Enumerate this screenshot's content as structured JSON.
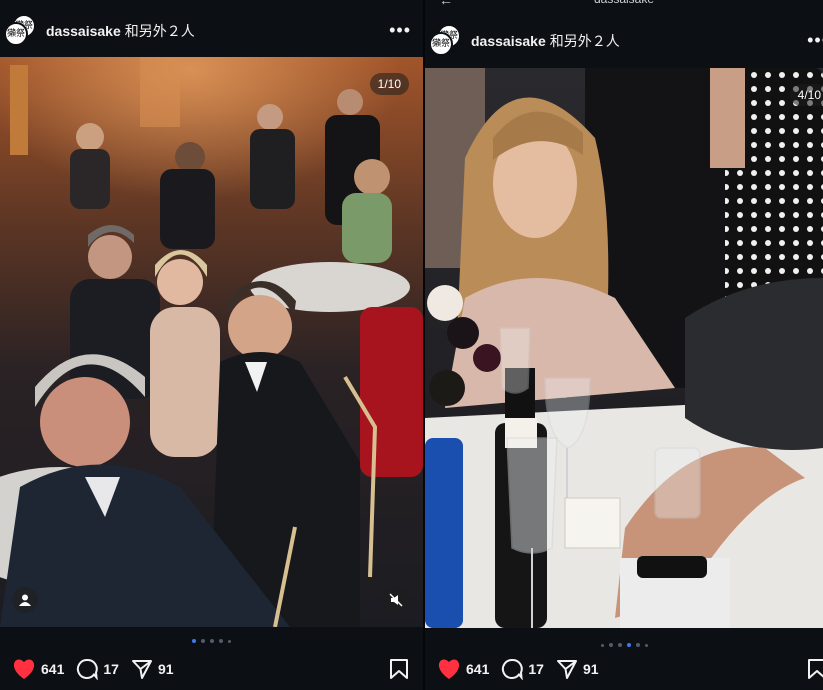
{
  "posts": [
    {
      "username": "dassaisake",
      "collab_text": "和另外２人",
      "avatar_text": "獺祭",
      "counter": "1/10",
      "likes": "641",
      "comments": "17",
      "shares": "91",
      "dots_active_index": 0
    },
    {
      "top_title": "dassaisake",
      "username": "dassaisake",
      "collab_text": "和另外２人",
      "avatar_text": "獺祭",
      "counter": "4/10",
      "likes": "641",
      "comments": "17",
      "shares": "91",
      "dots_active_index": 3
    }
  ],
  "colors": {
    "background": "#0c0f14",
    "like_red": "#ff3040",
    "dot_active": "#3c7bf0",
    "dot_inactive": "#555b66"
  },
  "icons": [
    "more-options-icon",
    "user-tag-icon",
    "mute-icon",
    "heart-icon",
    "comment-icon",
    "share-icon",
    "bookmark-icon",
    "back-arrow-icon"
  ]
}
